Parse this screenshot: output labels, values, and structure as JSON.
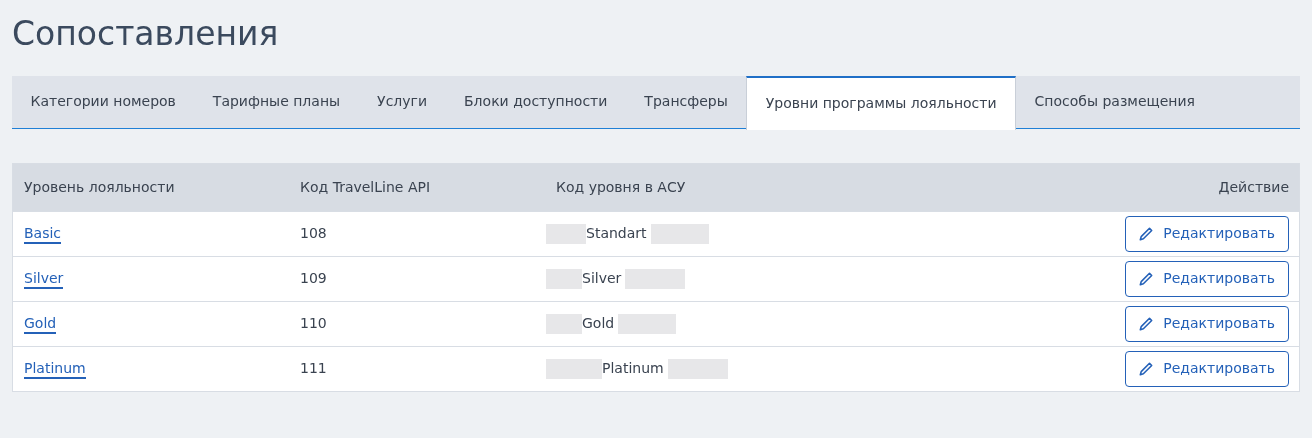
{
  "page_title": "Сопоставления",
  "tabs": [
    {
      "label": "Категории номеров",
      "selected": false
    },
    {
      "label": "Тарифные планы",
      "selected": false
    },
    {
      "label": "Услуги",
      "selected": false
    },
    {
      "label": "Блоки доступности",
      "selected": false
    },
    {
      "label": "Трансферы",
      "selected": false
    },
    {
      "label": "Уровни программы лояльности",
      "selected": true
    },
    {
      "label": "Способы размещения",
      "selected": false
    }
  ],
  "table": {
    "columns": [
      "Уровень лояльности",
      "Код TravelLine API",
      "Код уровня в АСУ",
      "Действие"
    ],
    "rows": [
      {
        "level": "Basic",
        "api_code": "108",
        "asu_code": "Standart",
        "action": "Редактировать"
      },
      {
        "level": "Silver",
        "api_code": "109",
        "asu_code": "Silver",
        "action": "Редактировать"
      },
      {
        "level": "Gold",
        "api_code": "110",
        "asu_code": "Gold",
        "action": "Редактировать"
      },
      {
        "level": "Platinum",
        "api_code": "111",
        "asu_code": "Platinum",
        "action": "Редактировать"
      }
    ]
  }
}
